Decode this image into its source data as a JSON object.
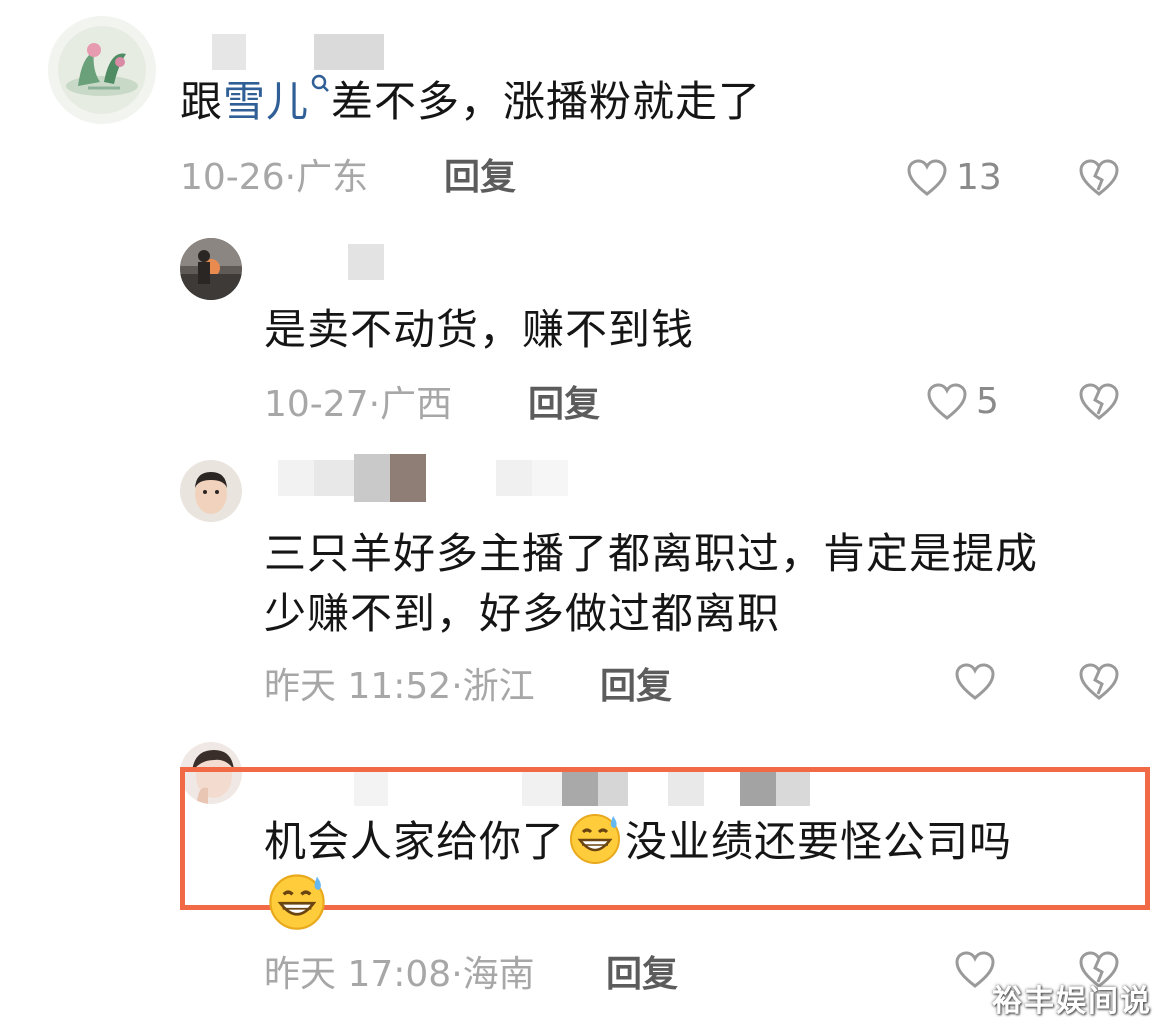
{
  "comments": [
    {
      "text_before": "跟",
      "mention": "雪儿",
      "text_after": "差不多，涨播粉就走了",
      "date": "10-26",
      "location": "广东",
      "reply": "回复",
      "likes": "13"
    },
    {
      "text": "是卖不动货，赚不到钱",
      "date": "10-27",
      "location": "广西",
      "reply": "回复",
      "likes": "5"
    },
    {
      "text_line1": "三只羊好多主播了都离职过，肯定是提成",
      "text_line2": "少赚不到，好多做过都离职",
      "date": "昨天 11:52",
      "location": "浙江",
      "reply": "回复",
      "likes": ""
    },
    {
      "text_part1": "机会人家给你了",
      "text_part2": "没业绩还要怪公司吗",
      "emoji": "grinning-sweat-emoji",
      "date": "昨天 17:08",
      "location": "海南",
      "reply": "回复",
      "likes": ""
    }
  ],
  "meta_separator": "·",
  "highlight_color": "#f26a45",
  "mention_color": "#2f5f96",
  "watermark": "裕丰娱间说"
}
